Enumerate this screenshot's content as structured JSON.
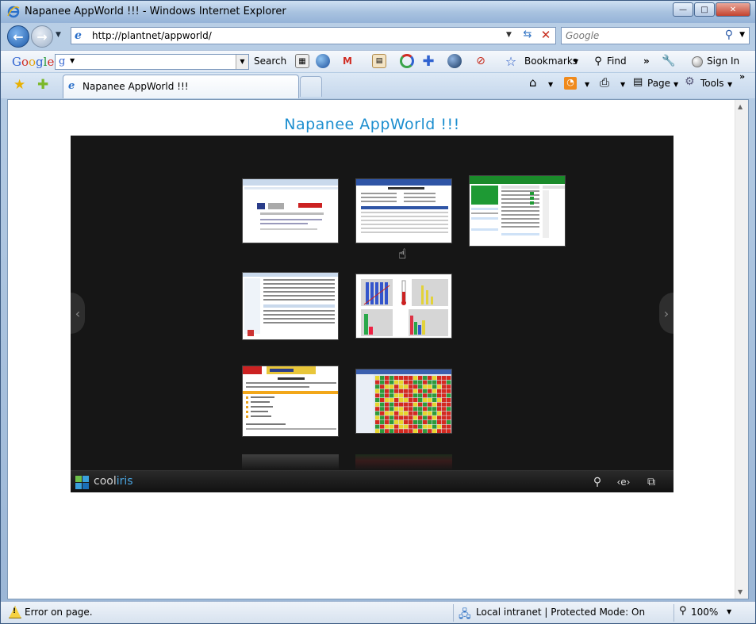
{
  "window": {
    "title": "Napanee AppWorld !!! - Windows Internet Explorer",
    "minimize": "—",
    "maximize": "□",
    "close": "✕"
  },
  "addressbar": {
    "url": "http://plantnet/appworld/",
    "search_placeholder": "Google"
  },
  "google_toolbar": {
    "logo": [
      "G",
      "o",
      "o",
      "g",
      "l",
      "e"
    ],
    "search_label": "Search",
    "bookmarks_label": "Bookmarks",
    "find_label": "Find",
    "signin_label": "Sign In"
  },
  "tabs": {
    "active_tab": "Napanee AppWorld !!!"
  },
  "commandbar": {
    "page_label": "Page",
    "tools_label": "Tools"
  },
  "page": {
    "title": "Napanee AppWorld !!!"
  },
  "cooliris": {
    "brand_cool": "cool",
    "brand_iris": "iris",
    "thumbnails": [
      {
        "kind": "browser-search-page"
      },
      {
        "kind": "web-form-table"
      },
      {
        "kind": "green-dashboard"
      },
      {
        "kind": "data-grid-report"
      },
      {
        "kind": "bar-charts"
      },
      {
        "kind": "yellow-banner-page"
      },
      {
        "kind": "heatmap-grid"
      }
    ]
  },
  "statusbar": {
    "status": "Error on page.",
    "zone": "Local intranet | Protected Mode: On",
    "zoom": "100%"
  },
  "colors": {
    "title_link": "#1c8ecf",
    "wall_bg": "#161616",
    "cooliris_accent": "#4aa5e0"
  }
}
